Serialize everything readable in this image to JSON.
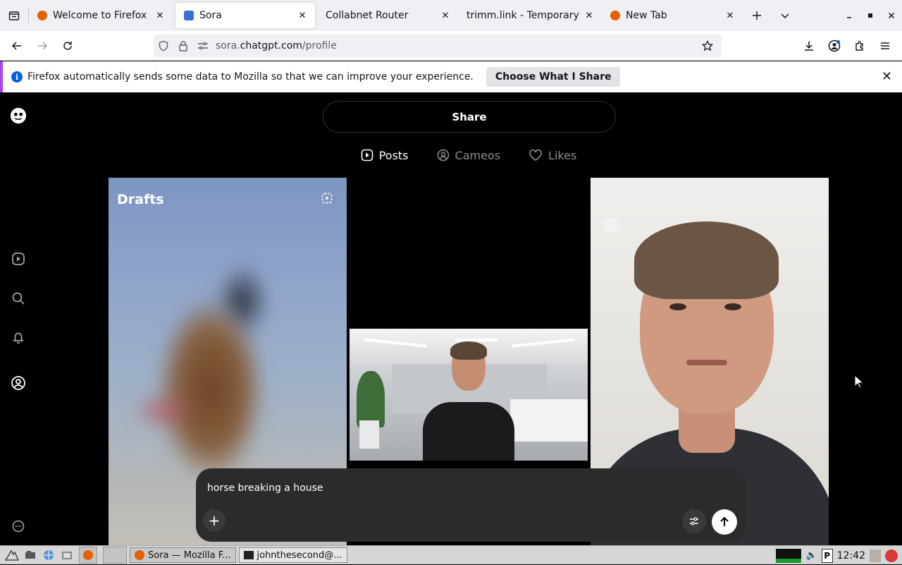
{
  "browser": {
    "tabs": [
      {
        "title": "Welcome to Firefox",
        "active": false,
        "favicon_color": "#e66000"
      },
      {
        "title": "Sora",
        "active": true,
        "favicon_color": "#3a6fd8"
      },
      {
        "title": "Collabnet Router",
        "active": false,
        "favicon_color": ""
      },
      {
        "title": "trimm.link - Temporary U",
        "active": false,
        "favicon_color": ""
      },
      {
        "title": "New Tab",
        "active": false,
        "favicon_color": "#e66000"
      }
    ],
    "url_scheme_path_prefix": "sora.",
    "url_host": "chatgpt.com",
    "url_path": "/profile",
    "notification": {
      "message": "Firefox automatically sends some data to Mozilla so that we can improve your experience.",
      "button": "Choose What I Share"
    }
  },
  "sora": {
    "share_label": "Share",
    "tabs": [
      {
        "label": "Posts",
        "active": true,
        "icon": "play-square-icon"
      },
      {
        "label": "Cameos",
        "active": false,
        "icon": "person-circle-icon"
      },
      {
        "label": "Likes",
        "active": false,
        "icon": "heart-icon"
      }
    ],
    "drafts_label": "Drafts",
    "composer": {
      "prompt": "horse breaking a house",
      "add_label": "+"
    }
  },
  "taskbar": {
    "tasks": [
      {
        "label": "Sora — Mozilla F...",
        "pressed": true
      },
      {
        "label": "johnthesecond@...",
        "pressed": false
      }
    ],
    "clock": "12:42"
  }
}
